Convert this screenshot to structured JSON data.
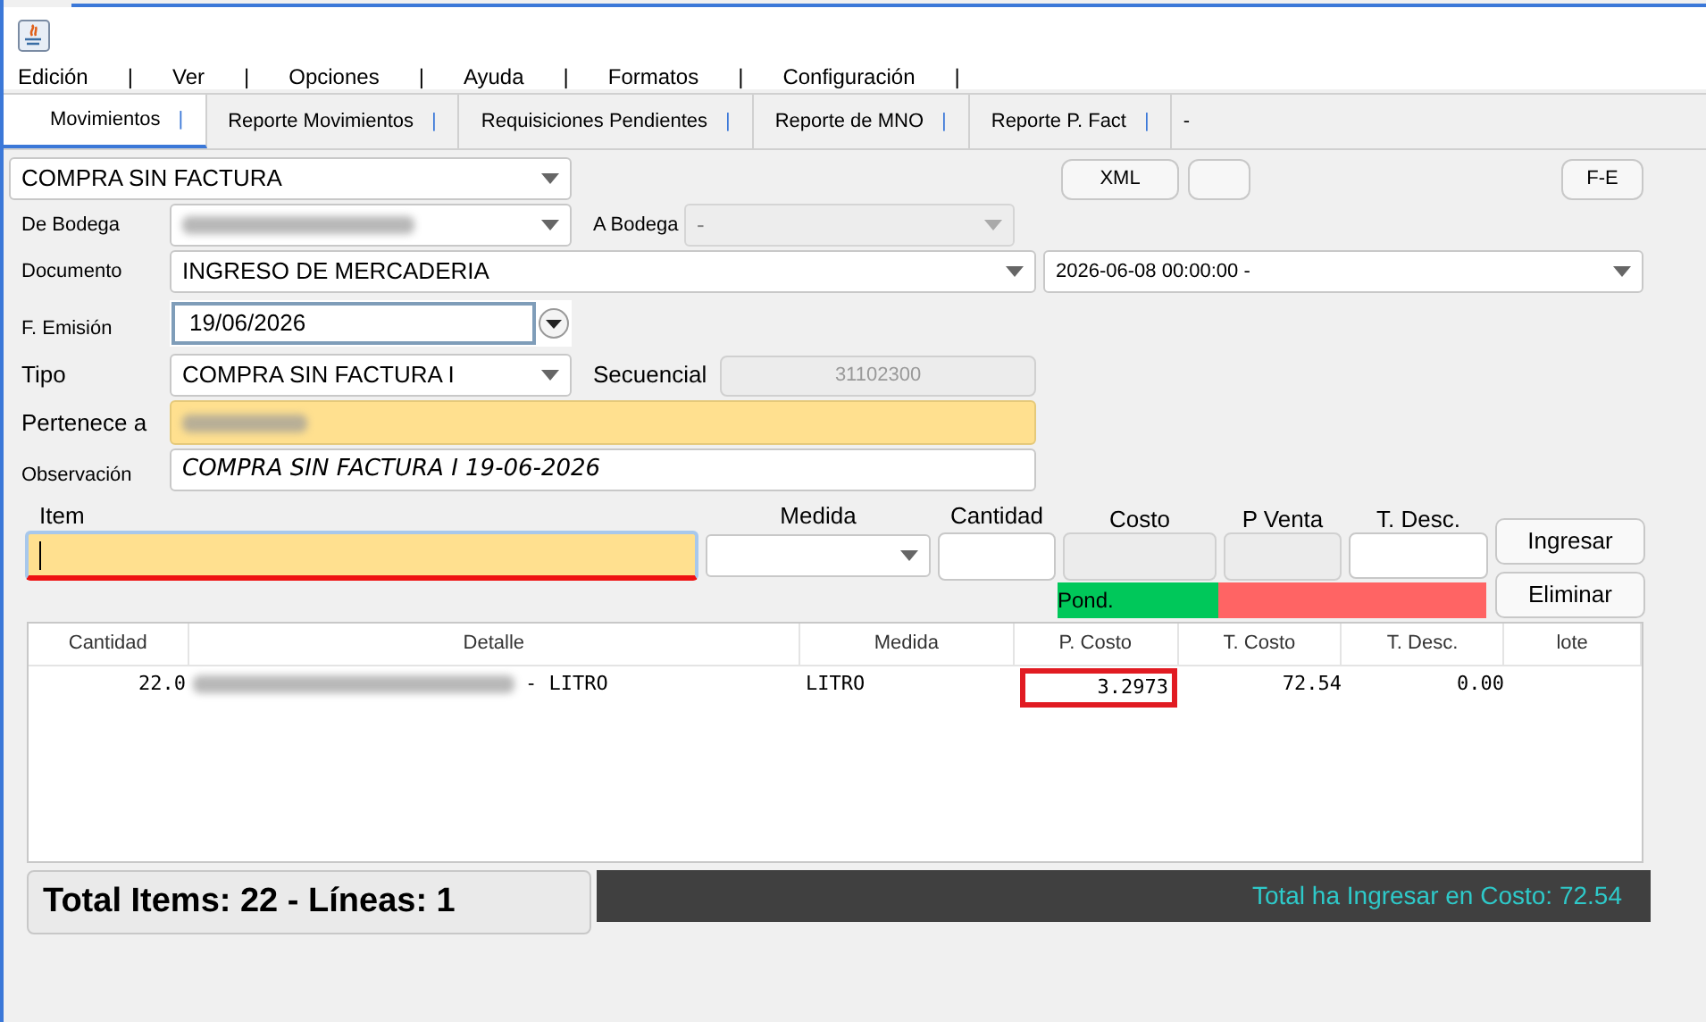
{
  "menu": [
    {
      "label": "Edición"
    },
    {
      "label": "Ver"
    },
    {
      "label": "Opciones"
    },
    {
      "label": "Ayuda"
    },
    {
      "label": "Formatos"
    },
    {
      "label": "Configuración"
    }
  ],
  "menu_separator": "|",
  "tabs": [
    {
      "label": "Movimientos",
      "separator": "|",
      "selected": true
    },
    {
      "label": "Reporte Movimientos",
      "separator": "|",
      "selected": false
    },
    {
      "label": "Requisiciones Pendientes",
      "separator": "|",
      "selected": false
    },
    {
      "label": "Reporte de MNO",
      "separator": "|",
      "selected": false
    },
    {
      "label": "Reporte P. Fact",
      "separator": "|",
      "selected": false
    }
  ],
  "tab_trailing": "-",
  "movement_type": {
    "value": "COMPRA SIN FACTURA"
  },
  "buttons": {
    "xml": "XML",
    "fe": "F-E"
  },
  "de_bodega": {
    "label": "De Bodega",
    "redacted": true
  },
  "a_bodega": {
    "label": "A Bodega",
    "value": "-"
  },
  "documento": {
    "label": "Documento",
    "value": "INGRESO DE MERCADERIA"
  },
  "document_date": {
    "value": "2026-06-08 00:00:00 -"
  },
  "emision": {
    "label": "F. Emisión",
    "value": "19/06/2026"
  },
  "tipo": {
    "label": "Tipo",
    "value": "COMPRA SIN FACTURA I"
  },
  "secuencial": {
    "label": "Secuencial",
    "value": "31102300"
  },
  "pertenece": {
    "label": "Pertenece a",
    "redacted": true
  },
  "observacion": {
    "label": "Observación",
    "value": "COMPRA SIN FACTURA I 19-06-2026"
  },
  "entry": {
    "item_label": "Item",
    "medida_label": "Medida",
    "cantidad_label": "Cantidad",
    "costo_label": "Costo",
    "pventa_label": "P Venta",
    "tdesc_label": "T. Desc."
  },
  "actions": {
    "ingresar": "Ingresar",
    "eliminar": "Eliminar"
  },
  "indicator": {
    "label": "Pond."
  },
  "table": {
    "columns": [
      "Cantidad",
      "Detalle",
      "Medida",
      "P. Costo",
      "T. Costo",
      "T. Desc.",
      "lote"
    ],
    "rows": [
      {
        "cells": [
          {
            "text": "22.0"
          },
          {
            "text": "- LITRO",
            "redacted_prefix": true
          },
          {
            "text": "LITRO"
          },
          {
            "text": "3.2973",
            "highlighted": true
          },
          {
            "text": "72.54"
          },
          {
            "text": "0.00"
          }
        ]
      }
    ]
  },
  "totals": {
    "items": "Total Items: 22 - Líneas: 1",
    "cost": "Total ha Ingresar en Costo: 72.54"
  }
}
